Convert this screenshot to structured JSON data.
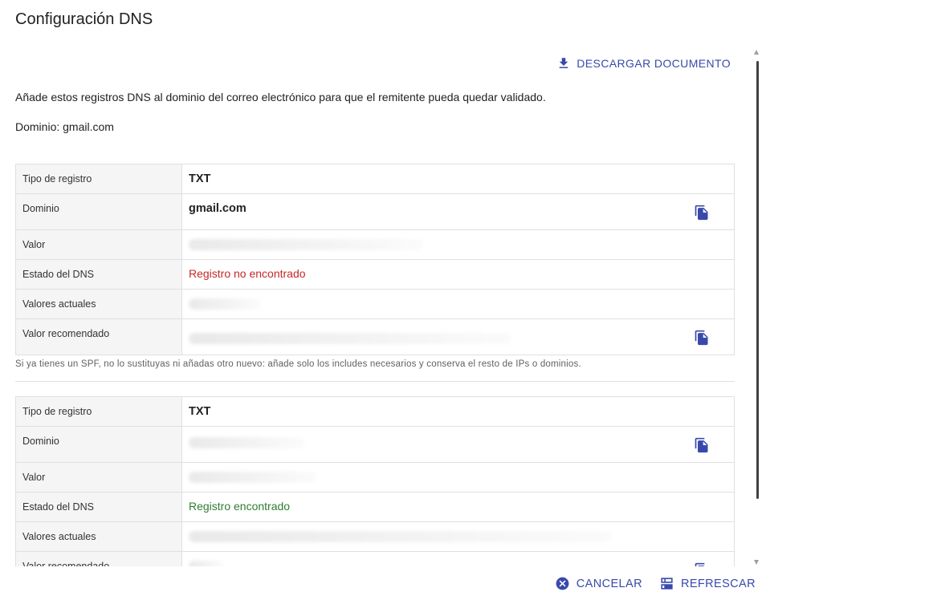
{
  "dialog": {
    "title": "Configuración DNS"
  },
  "toolbar": {
    "download_label": "DESCARGAR DOCUMENTO"
  },
  "intro_text": "Añade estos registros DNS al dominio del correo electrónico para que el remitente pueda quedar validado.",
  "domain_line": "Dominio: gmail.com",
  "labels": {
    "record_type": "Tipo de registro",
    "domain": "Dominio",
    "value": "Valor",
    "dns_status": "Estado del DNS",
    "current_values": "Valores actuales",
    "recommended_value": "Valor recomendado"
  },
  "records": [
    {
      "type": "TXT",
      "domain": "gmail.com",
      "status": "Registro no encontrado",
      "status_color": "#c62828"
    },
    {
      "type": "TXT",
      "status": "Registro encontrado",
      "status_color": "#2e7d32"
    }
  ],
  "spf_note": "Si ya tienes un SPF, no lo sustituyas ni añadas otro nuevo: añade solo los includes necesarios y conserva el resto de IPs o dominios.",
  "footer": {
    "cancel_label": "CANCELAR",
    "refresh_label": "REFRESCAR"
  },
  "colors": {
    "accent": "#3949ab",
    "error": "#c62828",
    "success": "#2e7d32"
  },
  "icons": {
    "download": "download-icon",
    "copy": "copy-icon",
    "cancel": "cancel-circle-icon",
    "refresh": "refresh-list-icon"
  }
}
